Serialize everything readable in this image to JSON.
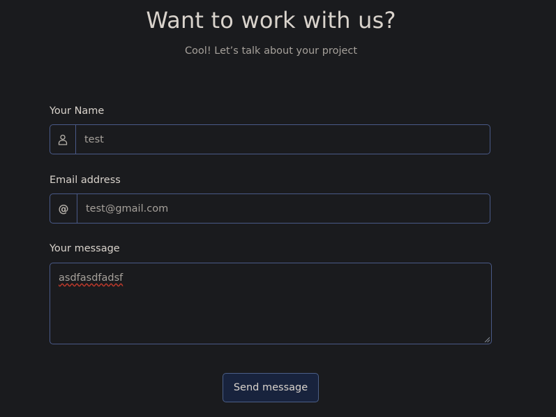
{
  "header": {
    "title": "Want to work with us?",
    "subtitle": "Cool! Let’s talk about your project"
  },
  "form": {
    "name": {
      "label": "Your Name",
      "value": "test",
      "icon": "user-icon"
    },
    "email": {
      "label": "Email address",
      "value": "test@gmail.com",
      "icon_text": "@"
    },
    "message": {
      "label": "Your message",
      "value": "asdfasdfadsf"
    },
    "submit_label": "Send message"
  },
  "colors": {
    "background": "#1a1b1e",
    "border_accent": "#4a5a88",
    "button_bg": "#18233d",
    "text": "#d9d3cc",
    "muted_text": "#a6a19b",
    "spellcheck": "#c0392b"
  }
}
